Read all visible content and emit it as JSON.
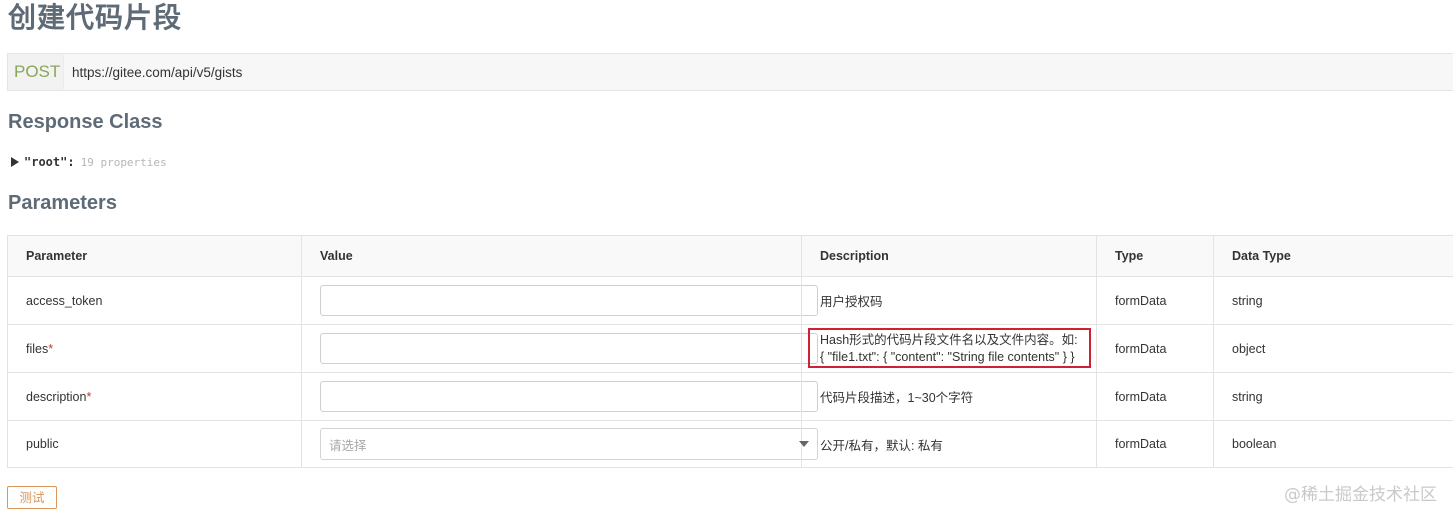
{
  "title": "创建代码片段",
  "endpoint": {
    "method": "POST",
    "url": "https://gitee.com/api/v5/gists"
  },
  "response_class": {
    "heading": "Response Class",
    "model_name": "\"root\":",
    "model_props": "19 properties"
  },
  "parameters": {
    "heading": "Parameters",
    "headers": [
      "Parameter",
      "Value",
      "Description",
      "Type",
      "Data Type"
    ],
    "rows": [
      {
        "name": "access_token",
        "required": "",
        "description": "用户授权码",
        "type": "formData",
        "data_type": "string"
      },
      {
        "name": "files",
        "required": "*",
        "description": "Hash形式的代码片段文件名以及文件内容。如: { \"file1.txt\": { \"content\": \"String file contents\" } }",
        "type": "formData",
        "data_type": "object"
      },
      {
        "name": "description",
        "required": "*",
        "description": "代码片段描述，1~30个字符",
        "type": "formData",
        "data_type": "string"
      },
      {
        "name": "public",
        "required": "",
        "description": "公开/私有，默认: 私有",
        "type": "formData",
        "data_type": "boolean",
        "select_placeholder": "请选择"
      }
    ]
  },
  "try_button": "测试",
  "watermark": "@稀土掘金技术社区",
  "colors": {
    "method": "#89a65b",
    "heading": "#5e6b76",
    "highlight": "#cc2233",
    "button": "#d9955a"
  }
}
